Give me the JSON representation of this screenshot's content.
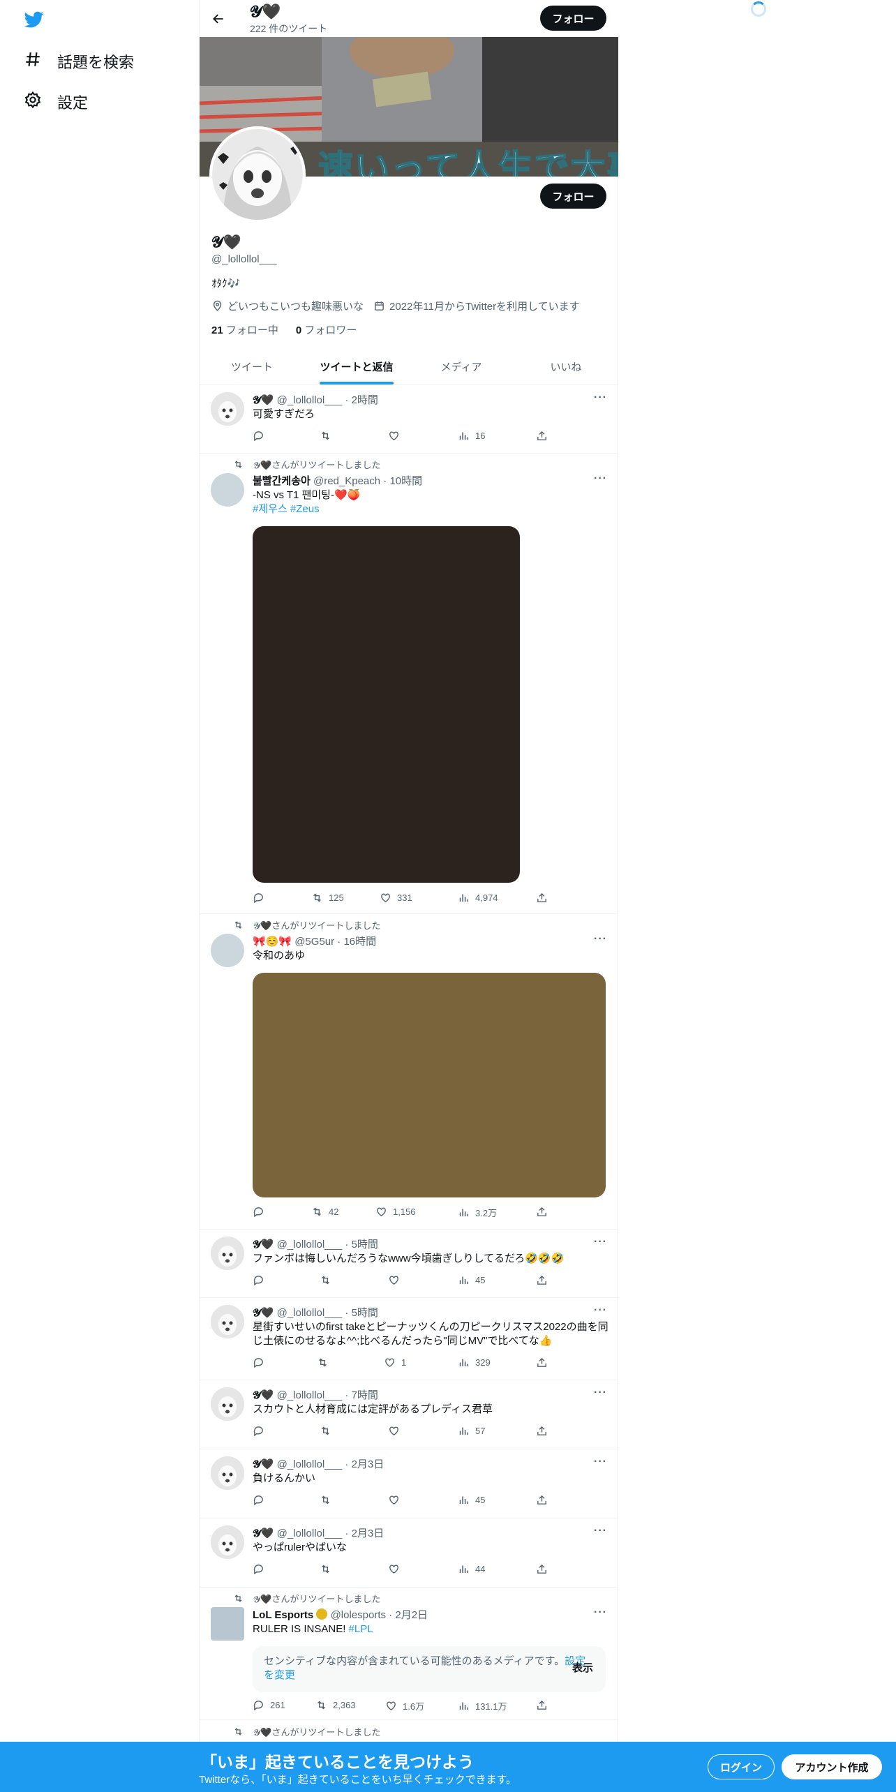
{
  "sidebar": {
    "items": [
      {
        "label": "話題を検索",
        "icon": "hashtag-icon"
      },
      {
        "label": "設定",
        "icon": "gear-icon"
      }
    ]
  },
  "header": {
    "name": "𝓨🖤",
    "tweet_count": "222 件のツイート",
    "follow_label": "フォロー"
  },
  "banner": {
    "overlay_text": "速いって人生で大事"
  },
  "profile": {
    "name": "𝓨🖤",
    "handle": "@_lollollol___",
    "follow_label": "フォロー",
    "bio": "ｵﾀｸ🎶",
    "location": "どいつもこいつも趣味悪いな",
    "joined": "2022年11月からTwitterを利用しています",
    "following_count": "21",
    "following_label": "フォロー中",
    "followers_count": "0",
    "followers_label": "フォロワー"
  },
  "tabs": [
    "ツイート",
    "ツイートと返信",
    "メディア",
    "いいね"
  ],
  "active_tab": "ツイートと返信",
  "tweets": [
    {
      "name": "𝓨🖤",
      "handle": "@_lollollol___",
      "time": "2時間",
      "text": "可愛すぎだろ",
      "replies": "",
      "retweets": "",
      "likes": "",
      "views": "16"
    },
    {
      "retweeted_by": "𝓨🖤さんがリツイートしました",
      "name": "불빨간케송아",
      "handle": "@red_Kpeach",
      "time": "10時間",
      "text": "-NS vs T1 팬미팅-❤️🍑",
      "tags": "#제우스 #Zeus",
      "media_color": "#2c231e",
      "replies": "",
      "retweets": "125",
      "likes": "331",
      "views": "4,974"
    },
    {
      "retweeted_by": "𝓨🖤さんがリツイートしました",
      "name": "🎀☺️🎀",
      "handle": "@5G5ur",
      "time": "16時間",
      "text": "令和のあゆ",
      "media_color": "#7a643c",
      "replies": "",
      "retweets": "42",
      "likes": "1,156",
      "views": "3.2万"
    },
    {
      "name": "𝓨🖤",
      "handle": "@_lollollol___",
      "time": "5時間",
      "text": "ファンボは悔しいんだろうなwww今頃歯ぎしりしてるだろ🤣🤣🤣",
      "replies": "",
      "retweets": "",
      "likes": "",
      "views": "45"
    },
    {
      "name": "𝓨🖤",
      "handle": "@_lollollol___",
      "time": "5時間",
      "text": "星街すいせいのfirst takeとピーナッツくんの刀ピークリスマス2022の曲を同じ土俵にのせるなよ^^;比べるんだったら\"同じMV\"で比べてな👍",
      "replies": "",
      "retweets": "",
      "likes": "1",
      "views": "329"
    },
    {
      "name": "𝓨🖤",
      "handle": "@_lollollol___",
      "time": "7時間",
      "text": "スカウトと人材育成には定評があるプレディス君草",
      "replies": "",
      "retweets": "",
      "likes": "",
      "views": "57"
    },
    {
      "name": "𝓨🖤",
      "handle": "@_lollollol___",
      "time": "2月3日",
      "text": "負けるんかい",
      "replies": "",
      "retweets": "",
      "likes": "",
      "views": "45"
    },
    {
      "name": "𝓨🖤",
      "handle": "@_lollollol___",
      "time": "2月3日",
      "text": "やっぱrulerやばいな",
      "replies": "",
      "retweets": "",
      "likes": "",
      "views": "44"
    },
    {
      "retweeted_by": "𝓨🖤さんがリツイートしました",
      "name": "LoL Esports",
      "verified": true,
      "handle": "@lolesports",
      "time": "2月2日",
      "text": "RULER IS INSANE!",
      "tags": "#LPL",
      "sensitive_text": "センシティブな内容が含まれている可能性のあるメディアです。",
      "sensitive_link": "設定を変更",
      "sensitive_show": "表示",
      "replies": "261",
      "retweets": "2,363",
      "likes": "1.6万",
      "views": "131.1万"
    }
  ],
  "partial_retweet_line": "𝓨🖤さんがリツイートしました",
  "bottom_bar": {
    "title": "「いま」起きていることを見つけよう",
    "subtitle": "Twitterなら、「いま」起きていることをいち早くチェックできます。",
    "login": "ログイン",
    "signup": "アカウント作成"
  },
  "colors": {
    "accent": "#1d9bf0",
    "text": "#0f1419",
    "muted": "#536471"
  }
}
